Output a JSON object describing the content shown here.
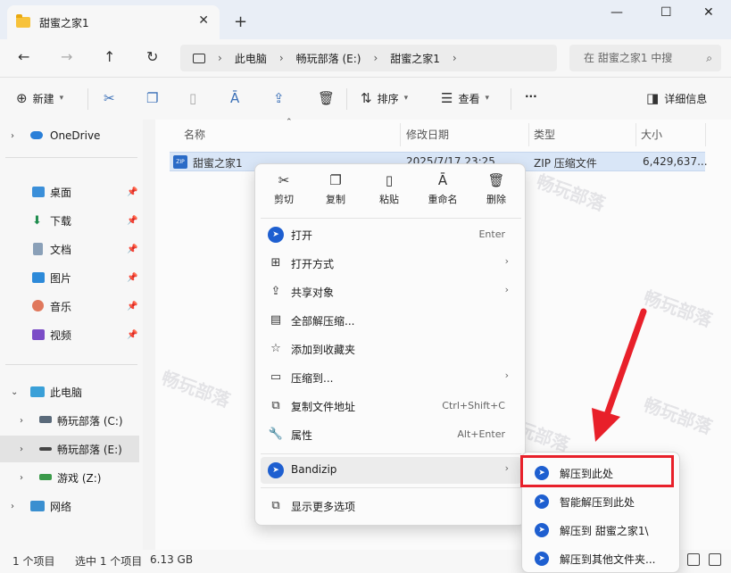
{
  "window": {
    "tab_title": "甜蜜之家1",
    "tab_close": "✕",
    "new_tab": "+",
    "minimize": "—",
    "maximize": "☐",
    "close": "✕"
  },
  "address": {
    "crumbs": [
      "此电脑",
      "畅玩部落 (E:)",
      "甜蜜之家1"
    ],
    "search_placeholder": "在 甜蜜之家1 中搜"
  },
  "toolbar": {
    "new_label": "新建",
    "sort_label": "排序",
    "view_label": "查看",
    "more_label": "···",
    "details_label": "详细信息"
  },
  "sidebar": {
    "onedrive": "OneDrive",
    "quick": [
      "桌面",
      "下载",
      "文档",
      "图片",
      "音乐",
      "视频"
    ],
    "this_pc": "此电脑",
    "drives": [
      "畅玩部落 (C:)",
      "畅玩部落 (E:)",
      "游戏 (Z:)"
    ],
    "network": "网络"
  },
  "columns": {
    "name": "名称",
    "date": "修改日期",
    "type": "类型",
    "size": "大小"
  },
  "file": {
    "name": "甜蜜之家1",
    "date": "2025/7/17 23:25",
    "type": "ZIP 压缩文件",
    "size": "6,429,637..."
  },
  "context_menu": {
    "top": [
      {
        "label": "剪切",
        "icon": "scissors-icon",
        "glyph": "✂"
      },
      {
        "label": "复制",
        "icon": "copy-icon",
        "glyph": "❐"
      },
      {
        "label": "粘贴",
        "icon": "paste-icon",
        "glyph": "📋"
      },
      {
        "label": "重命名",
        "icon": "rename-icon",
        "glyph": "Ā"
      },
      {
        "label": "删除",
        "icon": "trash-icon",
        "glyph": "🗑"
      }
    ],
    "items": [
      {
        "label": "打开",
        "shortcut": "Enter"
      },
      {
        "label": "打开方式"
      },
      {
        "label": "共享对象"
      },
      {
        "label": "全部解压缩..."
      },
      {
        "label": "添加到收藏夹"
      },
      {
        "label": "压缩到..."
      },
      {
        "label": "复制文件地址",
        "shortcut": "Ctrl+Shift+C"
      },
      {
        "label": "属性",
        "shortcut": "Alt+Enter"
      },
      {
        "label": "Bandizip"
      },
      {
        "label": "显示更多选项"
      }
    ]
  },
  "submenu": {
    "items": [
      "解压到此处",
      "智能解压到此处",
      "解压到 甜蜜之家1\\",
      "解压到其他文件夹..."
    ]
  },
  "statusbar": {
    "count": "1 个项目",
    "selected": "选中 1 个项目",
    "size": "6.13 GB"
  },
  "watermark": "畅玩部落",
  "colors": {
    "highlight_red": "#e8202a",
    "bandizip_blue": "#1e5fd0",
    "selection": "#d9e6f7"
  }
}
